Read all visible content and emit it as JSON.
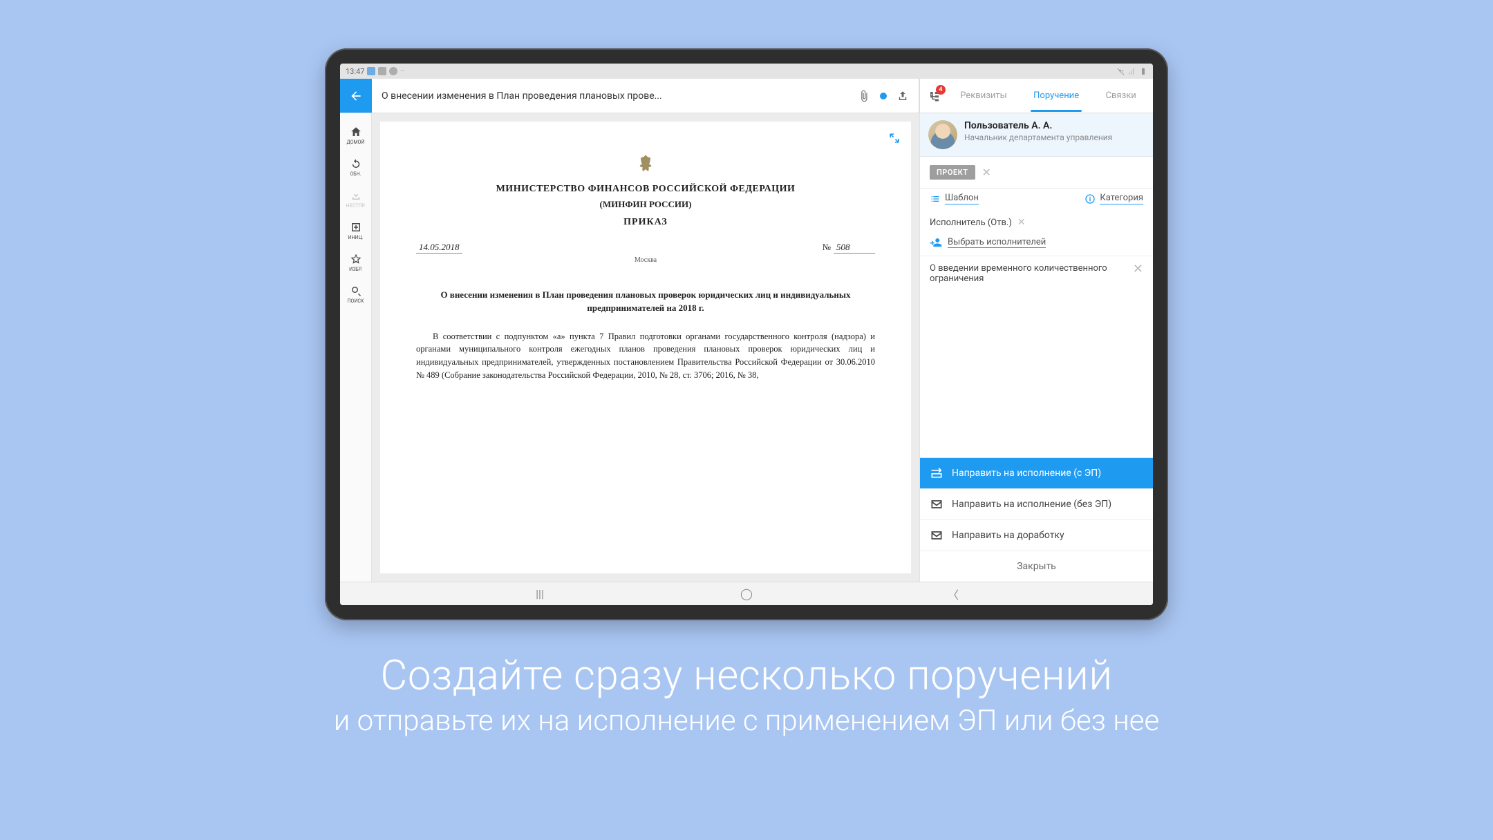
{
  "status_bar": {
    "time": "13:47"
  },
  "header": {
    "title": "О внесении изменения в План проведения плановых прове...",
    "tree_badge": "4",
    "tabs": {
      "requisites": "Реквизиты",
      "assignment": "Поручение",
      "links": "Связки"
    }
  },
  "left_nav": {
    "home": "ДОМОЙ",
    "refresh": "ОБН.",
    "download": "НЕОТПР.",
    "new": "ИНИЦ.",
    "favorites": "ИЗБР.",
    "search": "ПОИСК"
  },
  "document": {
    "ministry": "МИНИСТЕРСТВО ФИНАНСОВ РОССИЙСКОЙ ФЕДЕРАЦИИ",
    "minfin": "(МИНФИН РОССИИ)",
    "type": "ПРИКАЗ",
    "date": "14.05.2018",
    "num_prefix": "№",
    "number": "508",
    "city": "Москва",
    "heading": "О внесении изменения в План проведения плановых проверок юридических лиц и индивидуальных предпринимателей на 2018 г.",
    "body": "В соответствии с подпунктом «а» пункта 7 Правил подготовки органами государственного контроля (надзора) и органами муниципального контроля ежегодных планов проведения плановых проверок юридических лиц и индивидуальных предпринимателей, утвержденных постановлением Правительства Российской Федерации от 30.06.2010 № 489 (Собрание законодательства Российской Федерации, 2010, № 28, ст. 3706; 2016, № 38,"
  },
  "panel": {
    "user": {
      "name": "Пользователь А. А.",
      "role": "Начальник департамента управления"
    },
    "project_label": "ПРОЕКТ",
    "template_link": "Шаблон",
    "category_link": "Категория",
    "executor_resp": "Исполнитель (Отв.)",
    "add_executors": "Выбрать исполнителей",
    "note1": "О введении временного количественного ограничения",
    "actions": {
      "send_es": "Направить на исполнение (с ЭП)",
      "send_noes": "Направить на исполнение (без ЭП)",
      "send_rework": "Направить на доработку",
      "close": "Закрыть"
    }
  },
  "promo": {
    "line1": "Создайте сразу несколько поручений",
    "line2": "и отправьте их на исполнение с применением ЭП или без нее"
  }
}
